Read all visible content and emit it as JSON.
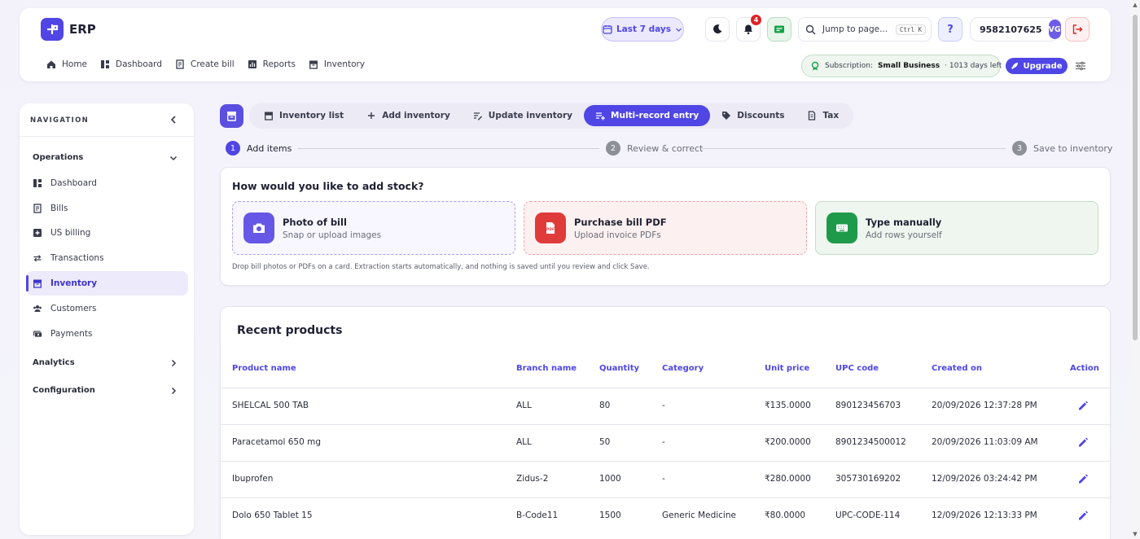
{
  "app": {
    "name": "ERP"
  },
  "topnav": [
    "Home",
    "Dashboard",
    "Create bill",
    "Reports",
    "Inventory"
  ],
  "header": {
    "date_range": "Last 7 days",
    "notification_count": "4",
    "search_placeholder": "Jump to page...",
    "search_shortcut": "Ctrl K",
    "help": "?",
    "phone": "9582107625",
    "avatar_initials": "VG",
    "subscription_label": "Subscription:",
    "subscription_plan": "Small Business",
    "subscription_days": "· 1013 days left",
    "upgrade": "Upgrade"
  },
  "sidebar": {
    "title": "NAVIGATION",
    "sections": {
      "operations": "Operations",
      "analytics": "Analytics",
      "configuration": "Configuration"
    },
    "items": [
      "Dashboard",
      "Bills",
      "US billing",
      "Transactions",
      "Inventory",
      "Customers",
      "Payments"
    ],
    "active_item": "Inventory"
  },
  "tabs": [
    "Inventory list",
    "Add inventory",
    "Update inventory",
    "Multi-record entry",
    "Discounts",
    "Tax"
  ],
  "active_tab": "Multi-record entry",
  "steps": [
    {
      "num": "1",
      "label": "Add items"
    },
    {
      "num": "2",
      "label": "Review & correct"
    },
    {
      "num": "3",
      "label": "Save to inventory"
    }
  ],
  "add_stock": {
    "title": "How would you like to add stock?",
    "options": [
      {
        "title": "Photo of bill",
        "subtitle": "Snap or upload images"
      },
      {
        "title": "Purchase bill PDF",
        "subtitle": "Upload invoice PDFs"
      },
      {
        "title": "Type manually",
        "subtitle": "Add rows yourself"
      }
    ],
    "hint": "Drop bill photos or PDFs on a card. Extraction starts automatically, and nothing is saved until you review and click Save."
  },
  "recent": {
    "title": "Recent products",
    "columns": [
      "Product name",
      "Branch name",
      "Quantity",
      "Category",
      "Unit price",
      "UPC code",
      "Created on",
      "Action"
    ],
    "rows": [
      [
        "SHELCAL 500 TAB",
        "ALL",
        "80",
        "-",
        "₹135.0000",
        "890123456703",
        "20/09/2026 12:37:28 PM"
      ],
      [
        "Paracetamol 650 mg",
        "ALL",
        "50",
        "-",
        "₹200.0000",
        "8901234500012",
        "20/09/2026 11:03:09 AM"
      ],
      [
        "Ibuprofen",
        "Zidus-2",
        "1000",
        "-",
        "₹280.0000",
        "305730169202",
        "12/09/2026 03:24:42 PM"
      ],
      [
        "Dolo 650 Tablet 15",
        "B-Code11",
        "1500",
        "Generic Medicine",
        "₹80.0000",
        "UPC-CODE-114",
        "12/09/2026 12:13:33 PM"
      ]
    ]
  }
}
